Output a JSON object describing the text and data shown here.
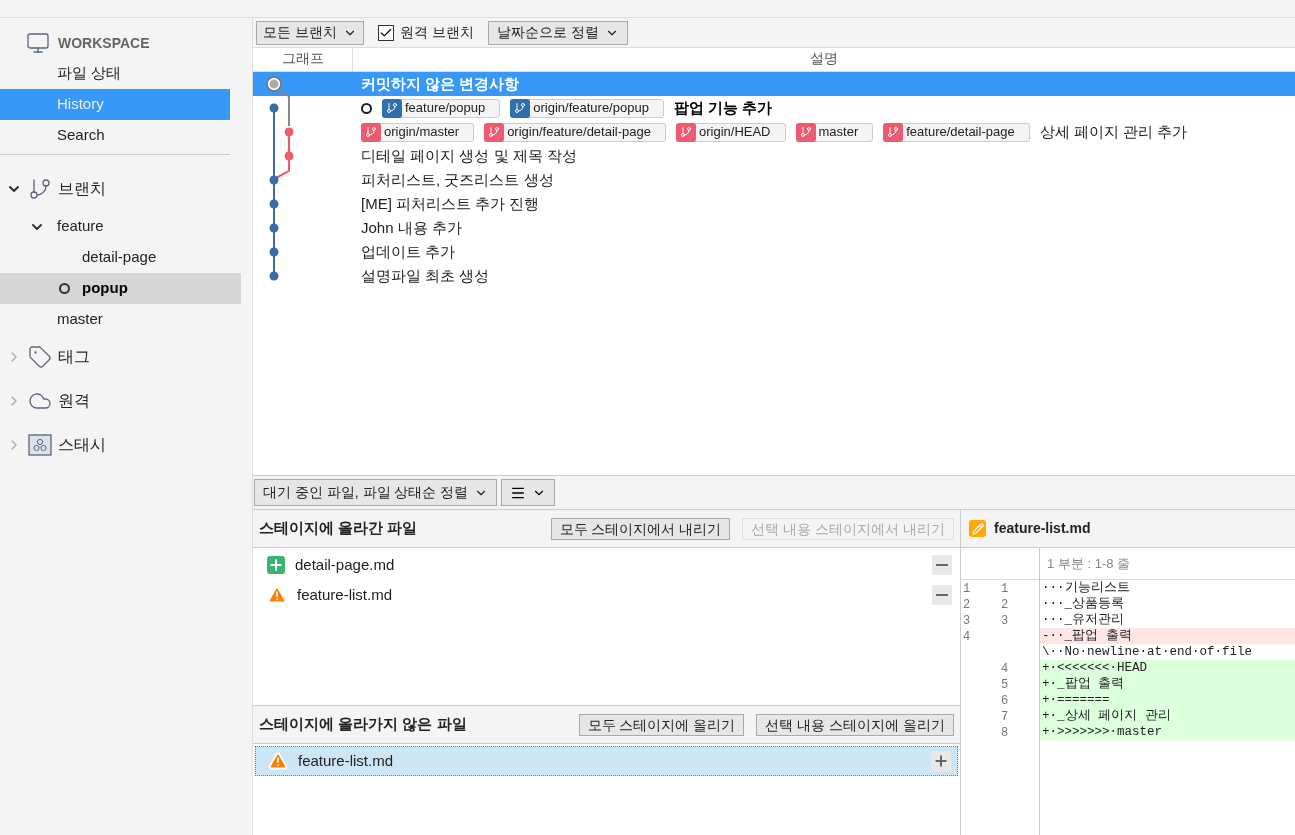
{
  "sidebar": {
    "workspace": {
      "title": "WORKSPACE",
      "items": [
        {
          "label": "파일 상태",
          "selected": false
        },
        {
          "label": "History",
          "selected": true
        },
        {
          "label": "Search",
          "selected": false
        }
      ]
    },
    "sections": [
      {
        "kind": "branch",
        "label": "브랜치",
        "expanded": true,
        "children": [
          {
            "label": "feature",
            "expanded": true,
            "selected": false,
            "current": false,
            "children": [
              {
                "label": "detail-page",
                "selected": false,
                "current": false
              },
              {
                "label": "popup",
                "selected": true,
                "current": true
              }
            ]
          },
          {
            "label": "master",
            "selected": false,
            "current": false
          }
        ]
      },
      {
        "kind": "tag",
        "label": "태그",
        "expanded": false
      },
      {
        "kind": "remote",
        "label": "원격",
        "expanded": false
      },
      {
        "kind": "stash",
        "label": "스태시",
        "expanded": false
      }
    ]
  },
  "toolbar": {
    "branch_filter": "모든 브랜치",
    "remote_branches": {
      "label": "원격 브랜치",
      "checked": true
    },
    "sort": "날짜순으로 정렬"
  },
  "history": {
    "columns": [
      "그래프",
      "설명"
    ],
    "commits": [
      {
        "kind": "uncommitted",
        "selected": true,
        "head": false,
        "message": "커밋하지 않은 변경사항"
      },
      {
        "kind": "main",
        "selected": false,
        "head": true,
        "refs": [
          {
            "label": "feature/popup",
            "color": "#2f6fae"
          },
          {
            "label": "origin/feature/popup",
            "color": "#2f6fae"
          }
        ],
        "message": "팝업 기능 추가"
      },
      {
        "kind": "side",
        "selected": false,
        "head": false,
        "refs": [
          {
            "label": "origin/master",
            "color": "#ee5a70"
          },
          {
            "label": "origin/feature/detail-page",
            "color": "#ee5a70"
          },
          {
            "label": "origin/HEAD",
            "color": "#ee5a70"
          },
          {
            "label": "master",
            "color": "#ee5a70"
          },
          {
            "label": "feature/detail-page",
            "color": "#ee5a70"
          }
        ],
        "message": "상세 페이지 관리 추가"
      },
      {
        "kind": "side",
        "selected": false,
        "head": false,
        "message": "디테일 페이지 생성 및 제목 작성"
      },
      {
        "kind": "merge",
        "selected": false,
        "head": false,
        "message": "피처리스트, 굿즈리스트 생성"
      },
      {
        "kind": "main",
        "selected": false,
        "head": false,
        "message": "[ME] 피처리스트 추가 진행"
      },
      {
        "kind": "main",
        "selected": false,
        "head": false,
        "message": "John 내용 추가"
      },
      {
        "kind": "main",
        "selected": false,
        "head": false,
        "message": "업데이트 추가"
      },
      {
        "kind": "main",
        "selected": false,
        "head": false,
        "message": "설명파일 최초 생성"
      }
    ]
  },
  "files_toolbar": {
    "sort": "대기 중인 파일, 파일 상태순 정렬"
  },
  "staged": {
    "title": "스테이지에 올라간 파일",
    "buttons": [
      {
        "label": "모두 스테이지에서 내리기",
        "disabled": false
      },
      {
        "label": "선택 내용 스테이지에서 내리기",
        "disabled": true
      }
    ],
    "files": [
      {
        "name": "detail-page.md",
        "kind": "added",
        "selected": false
      },
      {
        "name": "feature-list.md",
        "kind": "conflict",
        "selected": false
      }
    ]
  },
  "unstaged": {
    "title": "스테이지에 올라가지 않은 파일",
    "buttons": [
      {
        "label": "모두 스테이지에 올리기",
        "disabled": false
      },
      {
        "label": "선택 내용 스테이지에 올리기",
        "disabled": false
      }
    ],
    "files": [
      {
        "name": "feature-list.md",
        "kind": "conflict",
        "selected": true
      }
    ]
  },
  "diff": {
    "file": "feature-list.md",
    "hunk": "1 부분 : 1-8 줄",
    "lines": [
      {
        "kind": "context",
        "old": "1",
        "new": "1",
        "text": "···기능리스트"
      },
      {
        "kind": "context",
        "old": "2",
        "new": "2",
        "text": "···_상품등록"
      },
      {
        "kind": "context",
        "old": "3",
        "new": "3",
        "text": "···_유저관리"
      },
      {
        "kind": "removed",
        "old": "4",
        "text": "-··_팝업 출력"
      },
      {
        "kind": "note",
        "text": "\\··No·newline·at·end·of·file"
      },
      {
        "kind": "added",
        "new": "4",
        "text": "+·<<<<<<<·HEAD"
      },
      {
        "kind": "added",
        "new": "5",
        "text": "+·_팝업 출력"
      },
      {
        "kind": "added",
        "new": "6",
        "text": "+·======="
      },
      {
        "kind": "added",
        "new": "7",
        "text": "+·_상세 페이지 관리"
      },
      {
        "kind": "added",
        "new": "8",
        "text": "+·>>>>>>>·master"
      }
    ]
  }
}
